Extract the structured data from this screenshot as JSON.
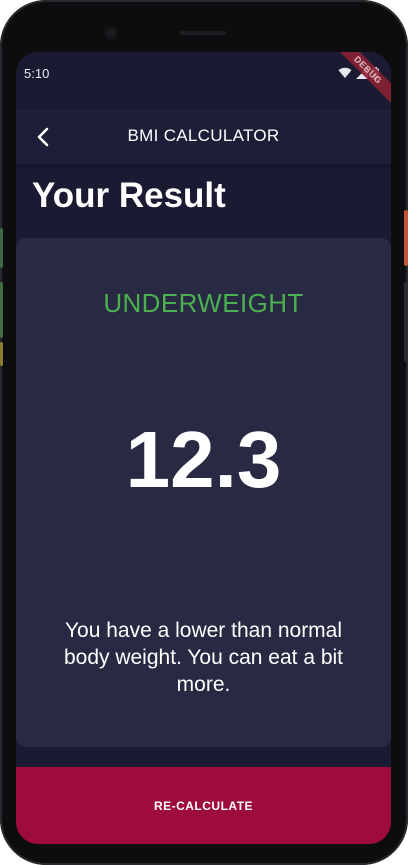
{
  "status_bar": {
    "time": "5:10",
    "debug_banner": "DEBUG"
  },
  "app_bar": {
    "title": "BMI CALCULATOR",
    "back_icon": "chevron-left-icon"
  },
  "page": {
    "heading": "Your Result"
  },
  "result": {
    "category": "UNDERWEIGHT",
    "bmi_value": "12.3",
    "advice": "You have a lower than normal body weight. You can eat a bit more."
  },
  "action": {
    "recalculate_label": "RE-CALCULATE"
  },
  "colors": {
    "background": "#1a1b32",
    "card": "#272a42",
    "category_green": "#4caf50",
    "accent_button": "#9e0b3d"
  }
}
